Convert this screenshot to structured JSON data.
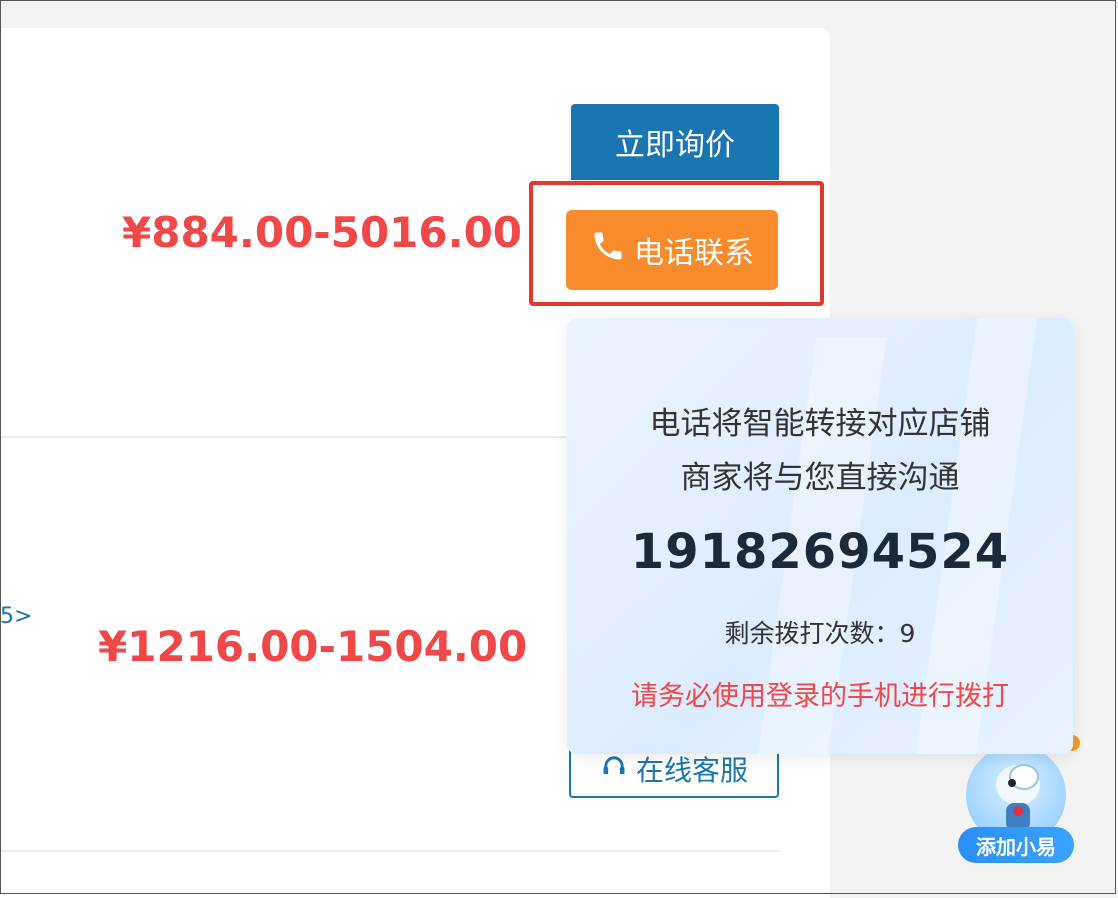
{
  "listing": {
    "item1": {
      "price": "¥884.00-5016.00",
      "inquiry_label": "立即询价",
      "phone_label": "电话联系"
    },
    "item2": {
      "price": "¥1216.00-1504.00",
      "service_label": "在线客服",
      "link_fragment": "5>"
    }
  },
  "phone_popup": {
    "line1": "电话将智能转接对应店铺",
    "line2": "商家将与您直接沟通",
    "phone_number": "19182694524",
    "remaining": "剩余拨打次数：9",
    "warning": "请务必使用登录的手机进行拨打"
  },
  "assistant": {
    "label": "添加小易"
  },
  "colors": {
    "price": "#f04848",
    "inquiry_bg": "#1a76b0",
    "phone_bg": "#f88c2c",
    "highlight": "#e03a30"
  },
  "icons": {
    "phone_button": "phone-icon",
    "service_button": "headset-icon"
  }
}
